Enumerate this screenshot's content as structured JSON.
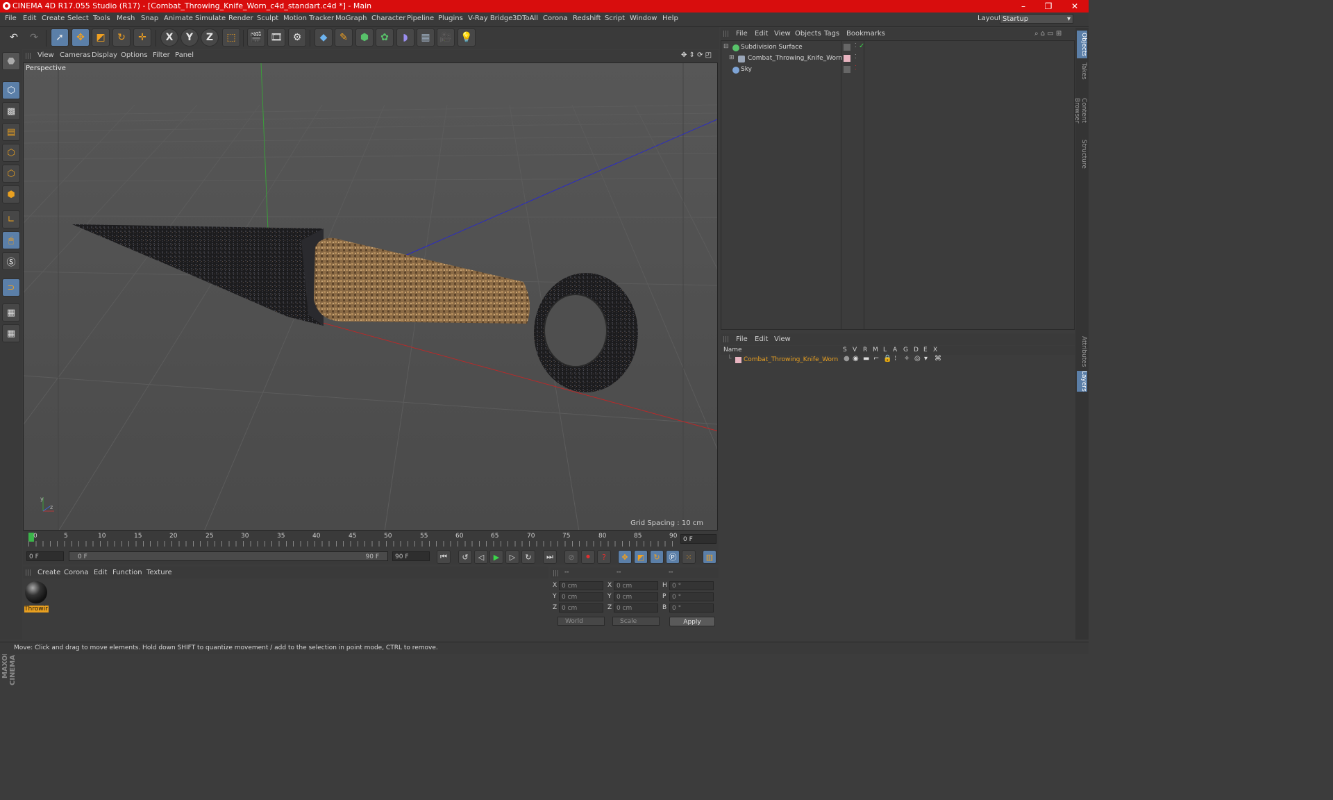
{
  "window": {
    "title": "CINEMA 4D R17.055 Studio (R17) - [Combat_Throwing_Knife_Worn_c4d_standart.c4d *] - Main",
    "min": "–",
    "max": "❐",
    "close": "✕"
  },
  "menubar": {
    "items": [
      "File",
      "Edit",
      "Create",
      "Select",
      "Tools",
      "Mesh",
      "Snap",
      "Animate",
      "Simulate",
      "Render",
      "Sculpt",
      "Motion Tracker",
      "MoGraph",
      "Character",
      "Pipeline",
      "Plugins",
      "V-Ray Bridge",
      "3DToAll",
      "Corona",
      "Redshift",
      "Script",
      "Window",
      "Help"
    ],
    "layout_label": "Layout:",
    "layout_value": "Startup"
  },
  "toolbar": {
    "x_axis": "X",
    "y_axis": "Y",
    "z_axis": "Z"
  },
  "viewport": {
    "menu": [
      "View",
      "Cameras",
      "Display",
      "Options",
      "Filter",
      "Panel"
    ],
    "name": "Perspective",
    "grid_spacing": "Grid Spacing : 10 cm"
  },
  "timeline": {
    "ticks": [
      "0",
      "5",
      "10",
      "15",
      "20",
      "25",
      "30",
      "35",
      "40",
      "45",
      "50",
      "55",
      "60",
      "65",
      "70",
      "75",
      "80",
      "85",
      "90"
    ],
    "current_frame": "0 F",
    "start_field": "0 F",
    "range_start": "0 F",
    "range_end": "90 F",
    "end_field": "90 F"
  },
  "material_manager": {
    "menu": [
      "Create",
      "Corona",
      "Edit",
      "Function",
      "Texture"
    ],
    "materials": [
      {
        "name": "Throwir"
      }
    ]
  },
  "coordinates": {
    "headers": [
      "--",
      "--",
      "--"
    ],
    "rows": [
      {
        "a": "X",
        "av": "0 cm",
        "b": "X",
        "bv": "0 cm",
        "c": "H",
        "cv": "0 °"
      },
      {
        "a": "Y",
        "av": "0 cm",
        "b": "Y",
        "bv": "0 cm",
        "c": "P",
        "cv": "0 °"
      },
      {
        "a": "Z",
        "av": "0 cm",
        "b": "Z",
        "bv": "0 cm",
        "c": "B",
        "cv": "0 °"
      }
    ],
    "mode": "World",
    "size_mode": "Scale",
    "apply": "Apply"
  },
  "object_manager": {
    "menu": [
      "File",
      "Edit",
      "View",
      "Objects",
      "Tags",
      "Bookmarks"
    ],
    "objects": [
      {
        "name": "Subdivision Surface",
        "icon_color": "#58c26a"
      },
      {
        "name": "Combat_Throwing_Knife_Worn",
        "icon_color": "#9aa6b8"
      },
      {
        "name": "Sky",
        "icon_color": "#7ea4d6"
      }
    ]
  },
  "layer_manager": {
    "menu": [
      "File",
      "Edit",
      "View"
    ],
    "columns": [
      "Name",
      "S",
      "V",
      "R",
      "M",
      "L",
      "A",
      "G",
      "D",
      "E",
      "X"
    ],
    "layers": [
      {
        "name": "Combat_Throwing_Knife_Worn",
        "color": "#e9a020"
      }
    ]
  },
  "side_tabs": [
    "Objects",
    "Takes",
    "Content Browser",
    "Structure",
    "Attributes",
    "Layers"
  ],
  "status": "Move: Click and drag to move elements. Hold down SHIFT to quantize movement / add to the selection in point mode, CTRL to remove.",
  "branding": "MAXON CINEMA 4D",
  "colors": {
    "accent": "#e9a020",
    "title_bar": "#d80d0d",
    "selection_blue": "#5b7fa8"
  }
}
